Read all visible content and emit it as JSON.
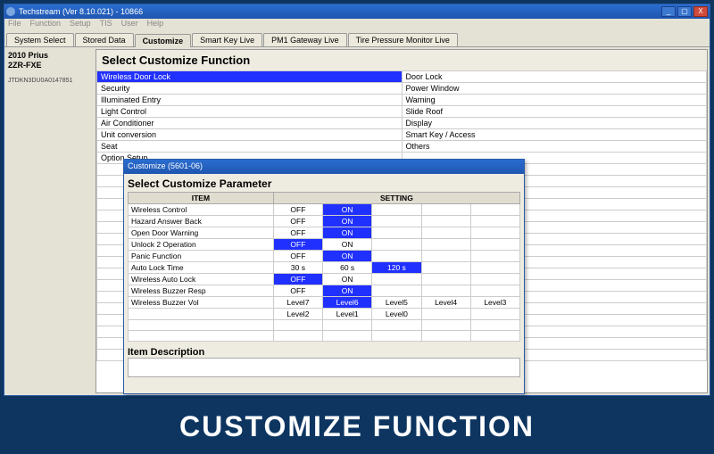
{
  "window": {
    "title": "Techstream (Ver 8.10.021) - 10866",
    "min": "_",
    "max": "▢",
    "close": "X"
  },
  "menu": {
    "items": [
      "File",
      "Function",
      "Setup",
      "TIS",
      "User",
      "Help"
    ]
  },
  "tabs": {
    "items": [
      "System Select",
      "Stored Data",
      "Customize",
      "Smart Key Live",
      "PM1 Gateway Live",
      "Tire Pressure Monitor Live"
    ],
    "active": 2
  },
  "sidebar": {
    "vehicle_line1": "2010 Prius",
    "vehicle_line2": "2ZR-FXE",
    "vin": "JTDKN3DU0A0147851"
  },
  "content": {
    "heading": "Select Customize Function",
    "functions_left": [
      "Wireless Door Lock",
      "Security",
      "Illuminated Entry",
      "Light Control",
      "Air Conditioner",
      "Unit conversion",
      "Seat",
      "Option Setup"
    ],
    "functions_right": [
      "Door Lock",
      "Power Window",
      "Warning",
      "Slide Roof",
      "Display",
      "Smart Key / Access",
      "Others",
      ""
    ],
    "selected_row": 0
  },
  "dialog": {
    "title": "Customize (5601-06)",
    "heading": "Select Customize Parameter",
    "col_item": "ITEM",
    "col_setting": "SETTING",
    "item_desc_label": "Item Description",
    "params": [
      {
        "item": "Wireless Control",
        "opts": [
          "OFF",
          "ON",
          "",
          "",
          ""
        ],
        "sel": 1
      },
      {
        "item": "Hazard Answer Back",
        "opts": [
          "OFF",
          "ON",
          "",
          "",
          ""
        ],
        "sel": 1
      },
      {
        "item": "Open Door Warning",
        "opts": [
          "OFF",
          "ON",
          "",
          "",
          ""
        ],
        "sel": 1
      },
      {
        "item": "Unlock 2 Operation",
        "opts": [
          "OFF",
          "ON",
          "",
          "",
          ""
        ],
        "sel": 0
      },
      {
        "item": "Panic Function",
        "opts": [
          "OFF",
          "ON",
          "",
          "",
          ""
        ],
        "sel": 1
      },
      {
        "item": "Auto Lock Time",
        "opts": [
          "30 s",
          "60 s",
          "120 s",
          "",
          ""
        ],
        "sel": 2
      },
      {
        "item": "Wireless Auto Lock",
        "opts": [
          "OFF",
          "ON",
          "",
          "",
          ""
        ],
        "sel": 0
      },
      {
        "item": "Wireless Buzzer Resp",
        "opts": [
          "OFF",
          "ON",
          "",
          "",
          ""
        ],
        "sel": 1
      },
      {
        "item": "Wireless Buzzer Vol",
        "opts": [
          "Level7",
          "Level6",
          "Level5",
          "Level4",
          "Level3"
        ],
        "sel": 1
      },
      {
        "item": "",
        "opts": [
          "Level2",
          "Level1",
          "Level0",
          "",
          ""
        ],
        "sel": -1
      },
      {
        "item": "",
        "opts": [
          "",
          "",
          "",
          "",
          ""
        ],
        "sel": -1
      },
      {
        "item": "",
        "opts": [
          "",
          "",
          "",
          "",
          ""
        ],
        "sel": -1
      }
    ]
  },
  "banner": {
    "text": "CUSTOMIZE FUNCTION"
  }
}
